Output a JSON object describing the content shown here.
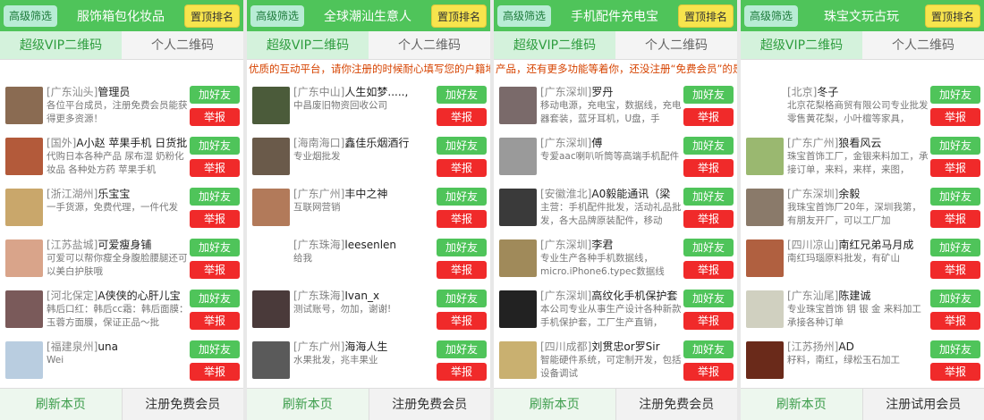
{
  "panels": [
    {
      "filter": "高级筛选",
      "title": "服饰箱包化妆品",
      "top": "置顶排名",
      "tab_active": "超级VIP二维码",
      "tab_other": "个人二维码",
      "marquee": "",
      "footer_refresh": "刷新本页",
      "footer_register": "注册免费会员",
      "rows": [
        {
          "loc": "[广东汕头]",
          "name": "管理员",
          "desc": "各位平台成员，注册免费会员能获得更多资源！",
          "avatar_color": "#8a6b52"
        },
        {
          "loc": "[国外]",
          "name": "A小赵 苹果手机 日货批",
          "desc": "代购日本各种产品 尿布湿 奶粉化妆品 各种处方药 苹果手机",
          "avatar_color": "#b35a3a"
        },
        {
          "loc": "[浙江湖州]",
          "name": "乐宝宝",
          "desc": "一手货源，免费代理，一件代发",
          "avatar_color": "#c9a76b"
        },
        {
          "loc": "[江苏盐城]",
          "name": "可爱瘦身铺",
          "desc": "可爱可以帮你瘦全身腹脸腰腿还可以美白护肤哦",
          "avatar_color": "#d9a48a"
        },
        {
          "loc": "[河北保定]",
          "name": "A侠侠的心肝儿宝",
          "desc": "韩后口红：韩后cc霜：韩后面膜：玉蓉方面膜，保证正品～批",
          "avatar_color": "#7a5a5a"
        },
        {
          "loc": "[福建泉州]",
          "name": "una",
          "desc": "Wei",
          "avatar_color": "#b9cde0"
        }
      ]
    },
    {
      "filter": "高级筛选",
      "title": "全球潮汕生意人",
      "top": "置顶排名",
      "tab_active": "超级VIP二维码",
      "tab_other": "个人二维码",
      "marquee": "优质的互动平台，请你注册的时候耐心填写您的户籍地",
      "footer_refresh": "刷新本页",
      "footer_register": "注册免费会员",
      "rows": [
        {
          "loc": "[广东中山]",
          "name": "人生如梦.....,",
          "desc": "中昌废旧物资回收公司",
          "avatar_color": "#4b5b3a"
        },
        {
          "loc": "[海南海口]",
          "name": "鑫佳乐烟酒行",
          "desc": "专业烟批发",
          "avatar_color": "#6a5a4a"
        },
        {
          "loc": "[广东广州]",
          "name": "丰中之神",
          "desc": "互联网营销",
          "avatar_color": "#b27a5a"
        },
        {
          "loc": "[广东珠海]",
          "name": "leesenlen",
          "desc": "给我",
          "avatar_color": "#ffffff"
        },
        {
          "loc": "[广东珠海]",
          "name": "Ivan_x",
          "desc": "测试账号，勿加，谢谢!",
          "avatar_color": "#4a3a3a"
        },
        {
          "loc": "[广东广州]",
          "name": "海海人生",
          "desc": "水果批发，兆丰果业",
          "avatar_color": "#5a5a5a"
        }
      ]
    },
    {
      "filter": "高级筛选",
      "title": "手机配件充电宝",
      "top": "置顶排名",
      "tab_active": "超级VIP二维码",
      "tab_other": "个人二维码",
      "marquee": "产品，还有更多功能等着你，还没注册“免费会员”的是",
      "footer_refresh": "刷新本页",
      "footer_register": "注册免费会员",
      "rows": [
        {
          "loc": "[广东深圳]",
          "name": "罗丹",
          "desc": "移动电源，充电宝，数据线，充电器套装，蓝牙耳机，U盘，手",
          "avatar_color": "#7a6a6a"
        },
        {
          "loc": "[广东深圳]",
          "name": "傅",
          "desc": "专爱aac喇叭听筒等高端手机配件",
          "avatar_color": "#9a9a9a"
        },
        {
          "loc": "[安徽淮北]",
          "name": "A0毅能通讯（梁",
          "desc": "主营：手机配件批发，活动礼品批发，各大品牌原装配件，移动",
          "avatar_color": "#3a3a3a"
        },
        {
          "loc": "[广东深圳]",
          "name": "李君",
          "desc": "专业生产各种手机数据线，micro.iPhone6.typec数据线",
          "avatar_color": "#a08a5a"
        },
        {
          "loc": "[广东深圳]",
          "name": "高纹化手机保护套",
          "desc": "本公司专业从事生产设计各种新款手机保护套，工厂生产直销，",
          "avatar_color": "#222222"
        },
        {
          "loc": "[四川成都]",
          "name": "刘贯忠or罗Sir",
          "desc": "智能硬件系统，可定制开发，包括设备调试",
          "avatar_color": "#c9b070"
        }
      ]
    },
    {
      "filter": "高级筛选",
      "title": "珠宝文玩古玩",
      "top": "置顶排名",
      "tab_active": "超级VIP二维码",
      "tab_other": "个人二维码",
      "marquee": "",
      "footer_refresh": "刷新本页",
      "footer_register": "注册试用会员",
      "rows": [
        {
          "loc": "[北京]",
          "name": "冬子",
          "desc": "北京花梨格商贸有限公司专业批发零售黄花梨，小叶檀等家具，",
          "avatar_color": "#ffffff"
        },
        {
          "loc": "[广东广州]",
          "name": "狼看风云",
          "desc": "珠宝首饰工厂，金银来料加工，承接订单，来料，来样，来图，",
          "avatar_color": "#9ab870"
        },
        {
          "loc": "[广东深圳]",
          "name": "余毅",
          "desc": "我珠宝首饰厂20年，深圳我第，有朋友开厂，可以工厂加",
          "avatar_color": "#8a7a6a"
        },
        {
          "loc": "[四川凉山]",
          "name": "南红兄弟马月成",
          "desc": "南红玛瑙原料批发，有矿山",
          "avatar_color": "#b06040"
        },
        {
          "loc": "[广东汕尾]",
          "name": "陈建诚",
          "desc": "专业珠宝首饰 钥 银 金 来料加工 承接各种订单",
          "avatar_color": "#d0d0c0"
        },
        {
          "loc": "[江苏扬州]",
          "name": "AD",
          "desc": "籽料，南红，绿松玉石加工",
          "avatar_color": "#6a2a1a"
        }
      ]
    }
  ],
  "row_buttons": {
    "add": "加好友",
    "report": "举报"
  }
}
